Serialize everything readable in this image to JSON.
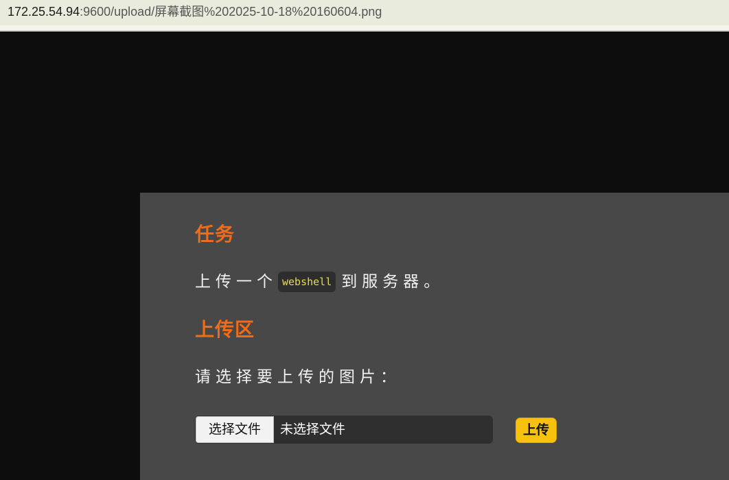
{
  "address_bar": {
    "url_host": "172.25.54.94",
    "url_rest": ":9600/upload/屏幕截图%202025-10-18%20160604.png"
  },
  "task_section": {
    "heading": "任务",
    "text_before": "上传一个",
    "code": "webshell",
    "text_after": "到服务器。"
  },
  "upload_section": {
    "heading": "上传区",
    "prompt": "请选择要上传的图片：",
    "choose_file_label": "选择文件",
    "no_file_label": "未选择文件",
    "upload_label": "上传"
  },
  "colors": {
    "page_background": "#0d0d0d",
    "panel_background": "#484848",
    "heading": "#f06c17",
    "code_text": "#e6db58",
    "upload_button": "#f7c20d"
  }
}
